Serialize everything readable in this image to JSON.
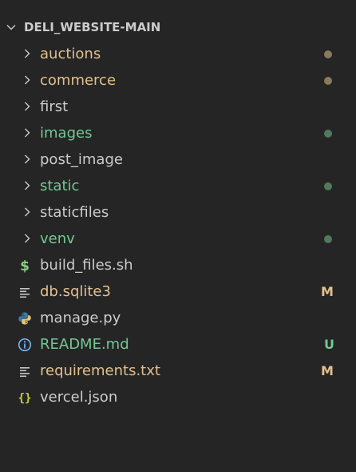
{
  "explorer": {
    "title": "DELI_WEBSITE-MAIN",
    "colors": {
      "background": "#252526",
      "default_text": "#cccccc",
      "modified": "#e2c08d",
      "untracked": "#73c991",
      "folder_modified_dot": "#8a7a5c",
      "folder_untracked_dot": "#4f7a5c",
      "shell_icon": "#89d185",
      "python_icon_blue": "#3b79b0",
      "python_icon_yellow": "#e5c56b",
      "info_icon": "#75beff",
      "json_icon": "#cbcb41",
      "lines_icon": "#c5c5c5"
    },
    "items": [
      {
        "label": "auctions",
        "kind": "folder",
        "status": "modified-dot"
      },
      {
        "label": "commerce",
        "kind": "folder",
        "status": "modified-dot"
      },
      {
        "label": "first",
        "kind": "folder",
        "status": ""
      },
      {
        "label": "images",
        "kind": "folder",
        "status": "untracked-dot"
      },
      {
        "label": "post_image",
        "kind": "folder",
        "status": ""
      },
      {
        "label": "static",
        "kind": "folder",
        "status": "untracked-dot"
      },
      {
        "label": "staticfiles",
        "kind": "folder",
        "status": ""
      },
      {
        "label": "venv",
        "kind": "folder",
        "status": "untracked-dot"
      },
      {
        "label": "build_files.sh",
        "kind": "file",
        "icon": "dollar-icon",
        "status": ""
      },
      {
        "label": "db.sqlite3",
        "kind": "file",
        "icon": "lines-icon",
        "status": "M"
      },
      {
        "label": "manage.py",
        "kind": "file",
        "icon": "python-icon",
        "status": ""
      },
      {
        "label": "README.md",
        "kind": "file",
        "icon": "info-icon",
        "status": "U"
      },
      {
        "label": "requirements.txt",
        "kind": "file",
        "icon": "lines-icon",
        "status": "M"
      },
      {
        "label": "vercel.json",
        "kind": "file",
        "icon": "braces-icon",
        "status": ""
      }
    ]
  }
}
